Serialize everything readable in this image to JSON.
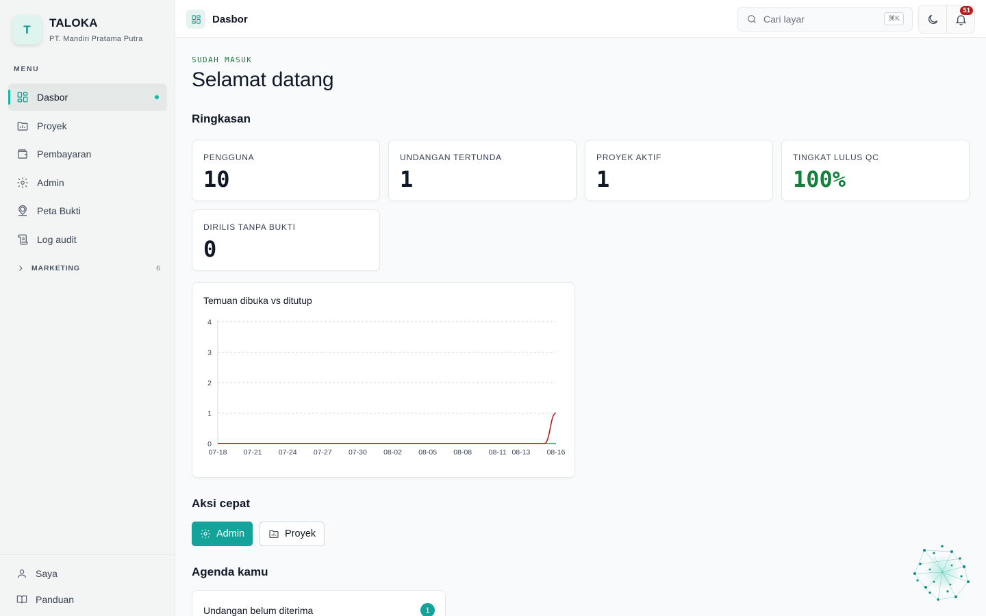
{
  "brand": {
    "name": "TALOKA",
    "subtitle": "PT. Mandiri Pratama Putra",
    "logo_letter": "T"
  },
  "sidebar": {
    "menu_label": "MENU",
    "items": [
      {
        "label": "Dasbor",
        "icon": "dashboard-icon",
        "active": true
      },
      {
        "label": "Proyek",
        "icon": "folder-icon"
      },
      {
        "label": "Pembayaran",
        "icon": "wallet-icon"
      },
      {
        "label": "Admin",
        "icon": "gear-icon"
      },
      {
        "label": "Peta Bukti",
        "icon": "map-pin-user-icon"
      },
      {
        "label": "Log audit",
        "icon": "scroll-icon"
      }
    ],
    "group": {
      "label": "MARKETING",
      "count": "6"
    },
    "bottom": [
      {
        "label": "Saya",
        "icon": "user-icon"
      },
      {
        "label": "Panduan",
        "icon": "book-icon"
      }
    ]
  },
  "header": {
    "title": "Dasbor",
    "search_placeholder": "Cari layar",
    "search_shortcut": "⌘K",
    "notification_count": "51"
  },
  "main": {
    "eyebrow": "SUDAH MASUK",
    "title": "Selamat datang",
    "summary_title": "Ringkasan",
    "stats": [
      {
        "label": "PENGGUNA",
        "value": "10"
      },
      {
        "label": "UNDANGAN TERTUNDA",
        "value": "1"
      },
      {
        "label": "PROYEK AKTIF",
        "value": "1"
      },
      {
        "label": "TINGKAT LULUS QC",
        "value": "100%",
        "color": "#15803d"
      },
      {
        "label": "DIRILIS TANPA BUKTI",
        "value": "0"
      }
    ],
    "quick_actions_title": "Aksi cepat",
    "quick_actions": [
      {
        "label": "Admin",
        "icon": "gear-icon",
        "style": "primary"
      },
      {
        "label": "Proyek",
        "icon": "folder-icon",
        "style": "secondary"
      }
    ],
    "agenda_title": "Agenda kamu",
    "agenda": [
      {
        "label": "Undangan belum diterima",
        "count": "1"
      }
    ]
  },
  "chart_data": {
    "type": "line",
    "title": "Temuan dibuka vs ditutup",
    "x": [
      "07-18",
      "07-19",
      "07-20",
      "07-21",
      "07-22",
      "07-23",
      "07-24",
      "07-25",
      "07-26",
      "07-27",
      "07-28",
      "07-29",
      "07-30",
      "07-31",
      "08-01",
      "08-02",
      "08-03",
      "08-04",
      "08-05",
      "08-06",
      "08-07",
      "08-08",
      "08-09",
      "08-10",
      "08-11",
      "08-12",
      "08-13",
      "08-14",
      "08-15",
      "08-16"
    ],
    "x_tick_labels": [
      "07-18",
      "07-21",
      "07-24",
      "07-27",
      "07-30",
      "08-02",
      "08-05",
      "08-08",
      "08-11",
      "08-13",
      "08-16"
    ],
    "series": [
      {
        "values": [
          0,
          0,
          0,
          0,
          0,
          0,
          0,
          0,
          0,
          0,
          0,
          0,
          0,
          0,
          0,
          0,
          0,
          0,
          0,
          0,
          0,
          0,
          0,
          0,
          0,
          0,
          0,
          0,
          0,
          1
        ],
        "color": "#b91c1c"
      },
      {
        "values": [
          0,
          0,
          0,
          0,
          0,
          0,
          0,
          0,
          0,
          0,
          0,
          0,
          0,
          0,
          0,
          0,
          0,
          0,
          0,
          0,
          0,
          0,
          0,
          0,
          0,
          0,
          0,
          0,
          0,
          0
        ],
        "color": "#16a34a"
      }
    ],
    "ylim": [
      0,
      4
    ],
    "yticks": [
      0,
      1,
      2,
      3,
      4
    ],
    "grid": true,
    "legend": "none"
  },
  "colors": {
    "accent": "#14a39a",
    "success": "#15803d",
    "danger": "#b91c1c"
  }
}
